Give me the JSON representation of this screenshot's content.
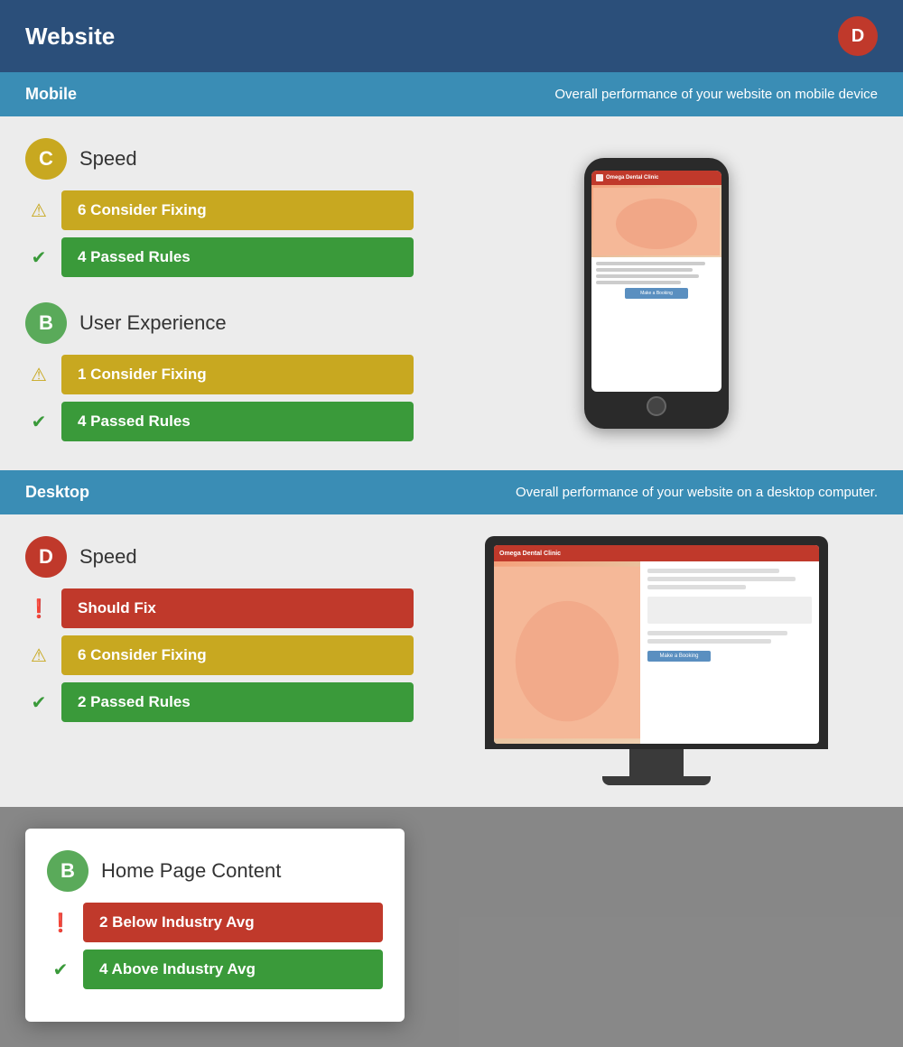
{
  "header": {
    "title": "Website",
    "avatar": "D"
  },
  "mobile": {
    "section_title": "Mobile",
    "section_desc": "Overall performance of your website on mobile device",
    "speed": {
      "label": "Speed",
      "grade": "C",
      "grade_class": "grade-c",
      "rules": [
        {
          "type": "warning",
          "bar_class": "bar-yellow",
          "text": "6 Consider Fixing"
        },
        {
          "type": "pass",
          "bar_class": "bar-green",
          "text": "4 Passed Rules"
        }
      ]
    },
    "ux": {
      "label": "User Experience",
      "grade": "B",
      "grade_class": "grade-b",
      "rules": [
        {
          "type": "warning",
          "bar_class": "bar-yellow",
          "text": "1 Consider Fixing"
        },
        {
          "type": "pass",
          "bar_class": "bar-green",
          "text": "4 Passed Rules"
        }
      ]
    }
  },
  "desktop": {
    "section_title": "Desktop",
    "section_desc": "Overall performance of your website on a desktop computer.",
    "speed": {
      "label": "Speed",
      "grade": "D",
      "grade_class": "grade-d",
      "rules": [
        {
          "type": "error",
          "bar_class": "bar-red",
          "text": "Should Fix"
        },
        {
          "type": "warning",
          "bar_class": "bar-yellow",
          "text": "6 Consider Fixing"
        },
        {
          "type": "pass",
          "bar_class": "bar-green",
          "text": "2 Passed Rules"
        }
      ]
    }
  },
  "popup": {
    "label": "Home Page Content",
    "grade": "B",
    "grade_class": "grade-b",
    "rules": [
      {
        "type": "error",
        "bar_class": "bar-red",
        "text": "2 Below Industry Avg"
      },
      {
        "type": "pass",
        "bar_class": "bar-green",
        "text": "4 Above Industry Avg"
      }
    ]
  },
  "icons": {
    "warning": "⚠",
    "pass": "✔",
    "error": "❗"
  }
}
